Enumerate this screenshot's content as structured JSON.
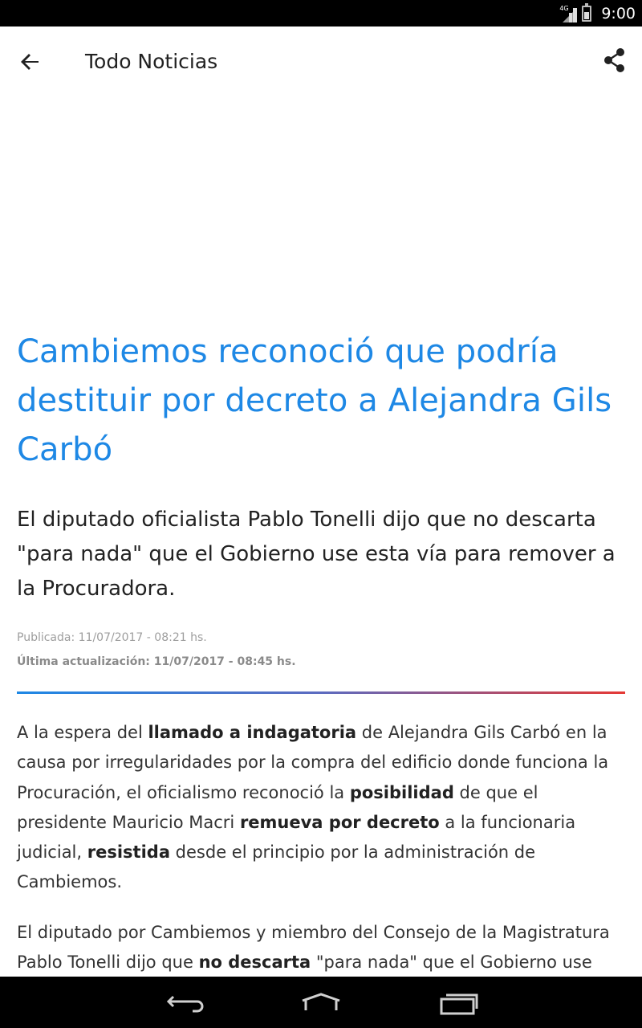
{
  "status_bar": {
    "network_label": "4G",
    "time": "9:00"
  },
  "app_bar": {
    "title": "Todo Noticias",
    "back_icon": "arrow-left-icon",
    "share_icon": "share-icon"
  },
  "article": {
    "headline": "Cambiemos reconoció que podría destituir por decreto a Alejandra Gils Carbó",
    "subheadline": "El diputado oficialista Pablo Tonelli dijo que no descarta \"para nada\" que el Gobierno use esta vía para remover a la Procuradora.",
    "published": "Publicada: 11/07/2017 - 08:21 hs.",
    "updated": "Última actualización: 11/07/2017 - 08:45 hs.",
    "paragraph1": {
      "t1": "A la espera del ",
      "b1": "llamado a indagatoria",
      "t2": " de Alejandra Gils Carbó en la causa por irregularidades por la compra del edificio donde funciona la Procuración, el oficialismo reconoció la ",
      "b2": "posibilidad",
      "t3": " de que el presidente Mauricio Macri ",
      "b3": "remueva por decreto",
      "t4": " a la funcionaria judicial, ",
      "b4": "resistida",
      "t5": " desde el principio por la administración de Cambiemos."
    },
    "paragraph2": {
      "t1": "El diputado por Cambiemos y miembro del Consejo de la Magistratura Pablo Tonelli dijo que ",
      "b1": "no descarta",
      "t2": " \"para nada\" que el Gobierno use esta vía para remover a la Procuradora y recordó que"
    },
    "divider_colors": [
      "#1e88e5",
      "#5c6bc0",
      "#e53935"
    ]
  },
  "nav_bar": {
    "back_icon": "nav-back-icon",
    "home_icon": "nav-home-icon",
    "recents_icon": "nav-recents-icon"
  }
}
